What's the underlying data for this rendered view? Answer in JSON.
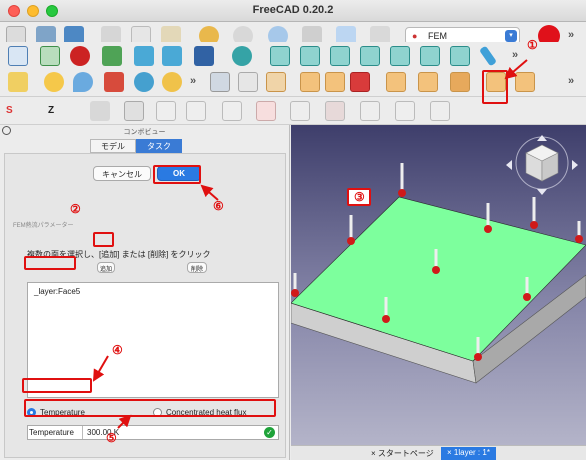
{
  "window": {
    "title": "FreeCAD 0.20.2"
  },
  "workbench": {
    "selected": "FEM"
  },
  "combo_view": {
    "title": "コンボビュー",
    "tabs": [
      "モデル",
      "タスク"
    ]
  },
  "task": {
    "cancel_label": "キャンセル",
    "ok_label": "OK",
    "group_title": "FEM熱流パラメーター",
    "hint": "複数の面を選択し、[追加] または [削除] をクリック",
    "add_label": "追加",
    "remove_label": "削除",
    "references": [
      "_layer:Face5"
    ],
    "option_temperature": "Temperature",
    "option_heat_flux": "Concentrated heat flux",
    "temperature_label": "Temperature",
    "temperature_value": "300.00 K"
  },
  "annotations": [
    "①",
    "②",
    "③",
    "④",
    "⑤",
    "⑥"
  ],
  "document_tabs": [
    "スタートページ",
    "1layer : 1*"
  ],
  "colors": {
    "accent": "#2a7ae2",
    "highlight": "#e01010",
    "face_selected": "#7dff9d"
  }
}
